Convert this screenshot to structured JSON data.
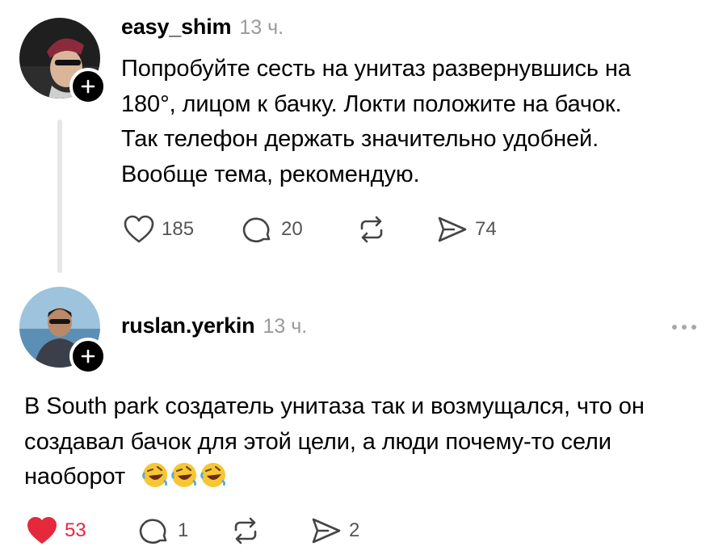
{
  "posts": [
    {
      "username": "easy_shim",
      "time": "13 ч.",
      "lines": [
        "Попробуйте сесть на унитаз развернувшись на",
        "180°, лицом к бачку. Локти положите на бачок.",
        "Так телефон держать значительно удобней.",
        "Вообще тема, рекомендую."
      ],
      "likes": "185",
      "replies": "20",
      "shares": "74",
      "liked": false
    },
    {
      "username": "ruslan.yerkin",
      "time": "13 ч.",
      "lines": [
        "В South park создатель унитаза так и возмущался, что он",
        "создавал бачок для этой цели, а люди почему-то сели",
        "наоборот"
      ],
      "emojis": [
        "rolling-on-floor-laughing",
        "rolling-on-floor-laughing",
        "rolling-on-floor-laughing"
      ],
      "likes": "53",
      "replies": "1",
      "shares": "2",
      "liked": true
    }
  ],
  "colors": {
    "liked": "#e5283c",
    "meta": "#9a9a9a",
    "icon": "#444444"
  }
}
